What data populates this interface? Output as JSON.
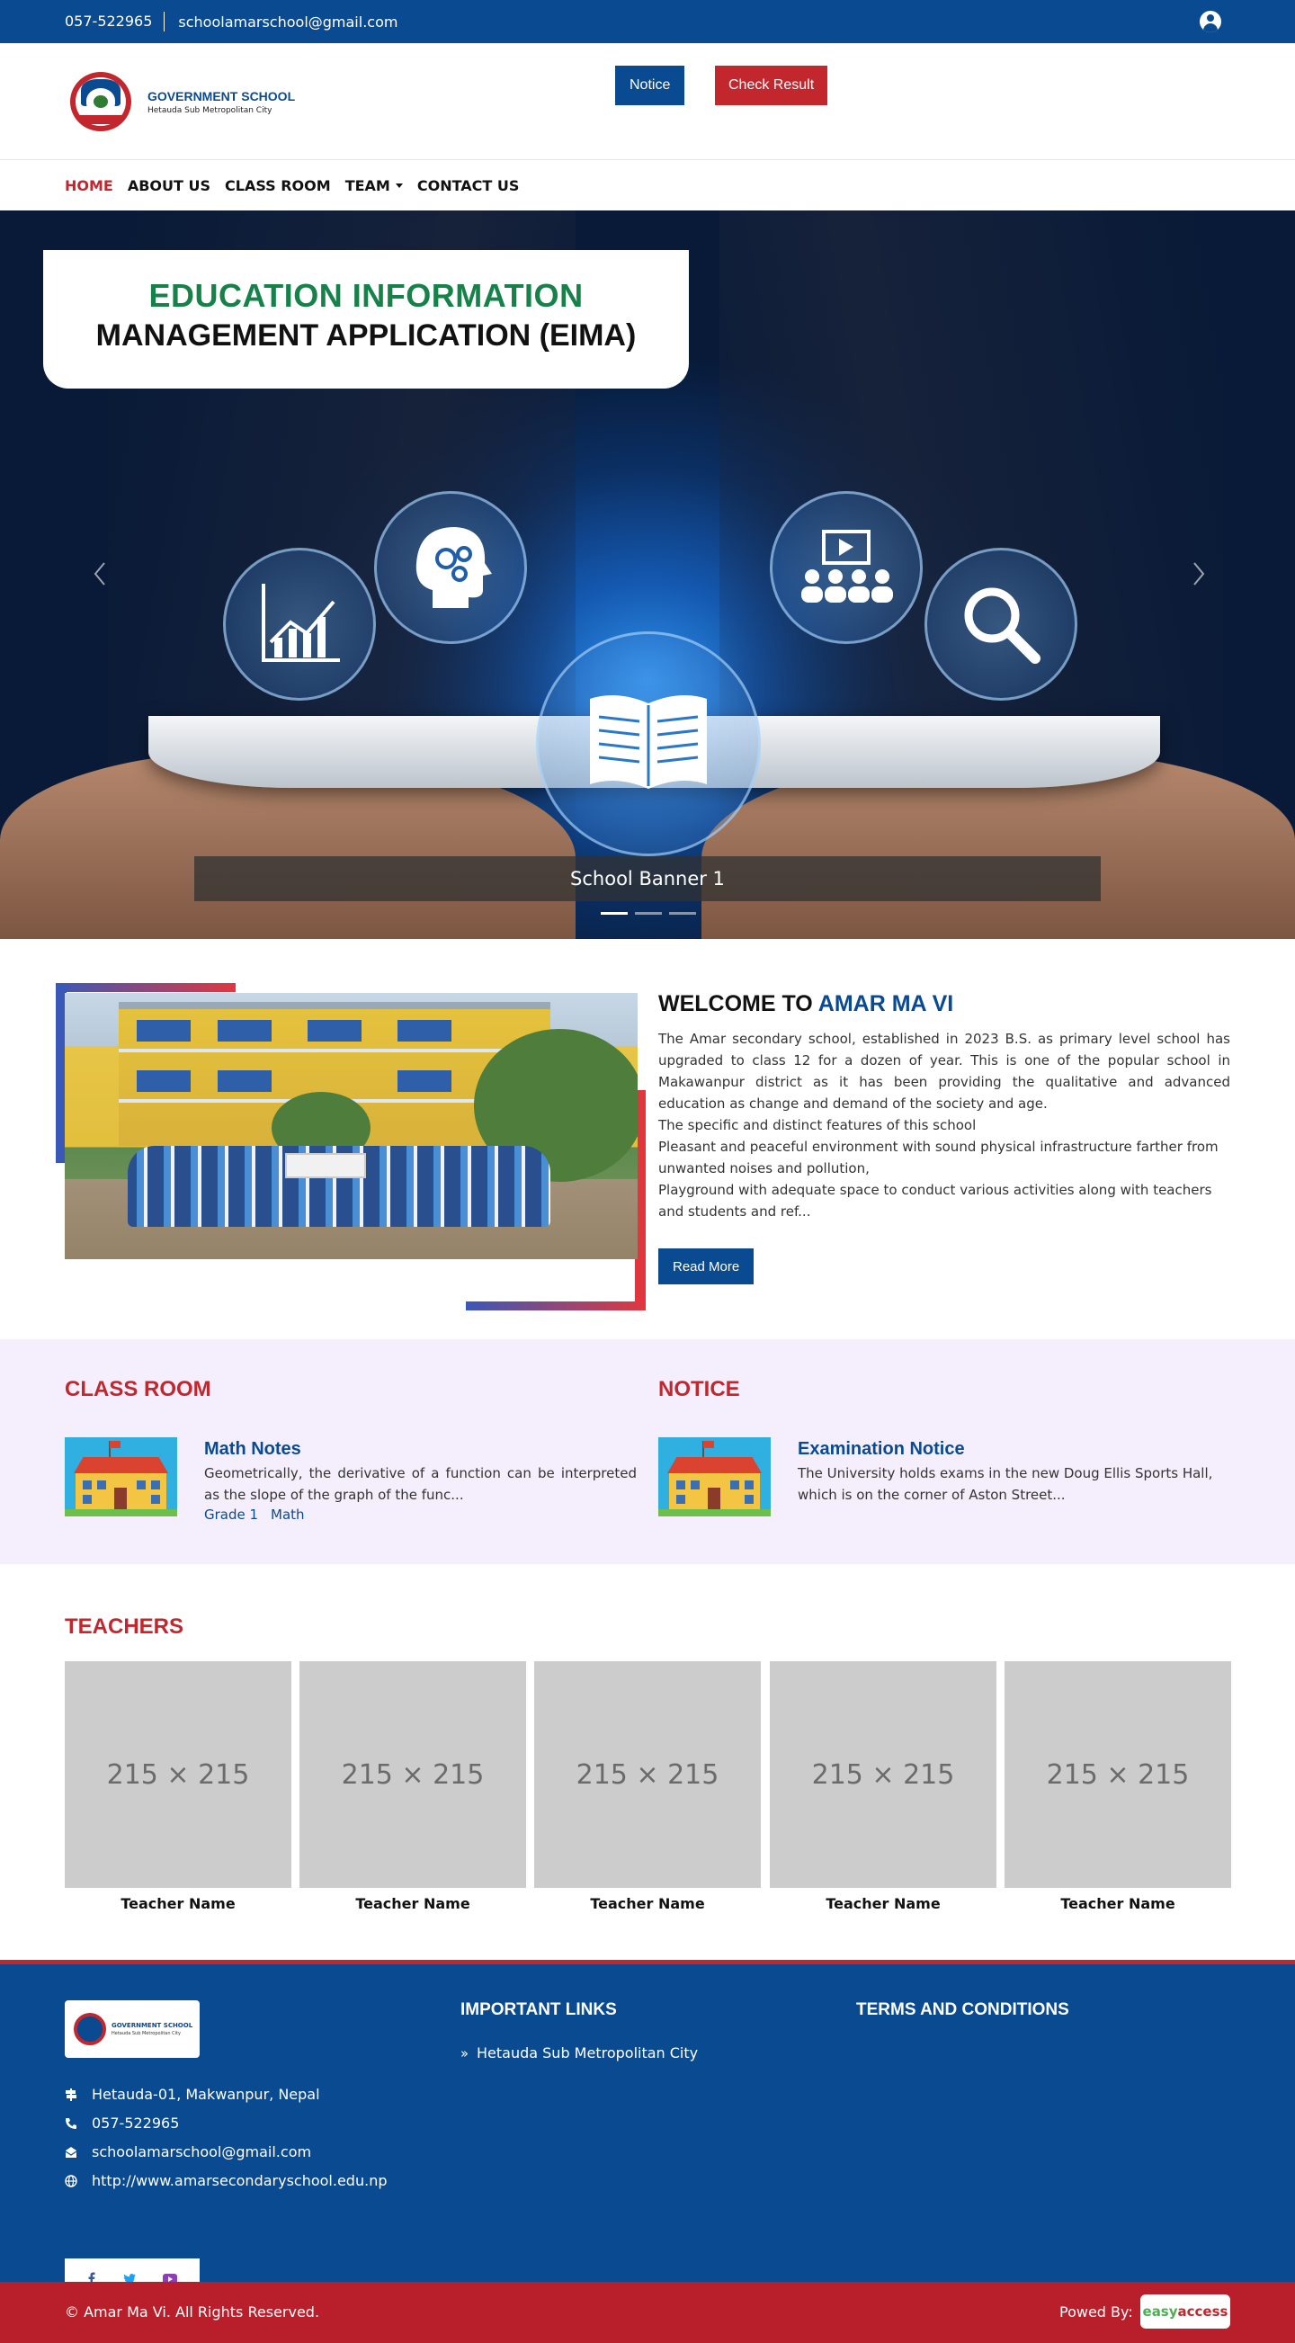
{
  "topbar": {
    "phone": "057-522965",
    "email": "schoolamarschool@gmail.com"
  },
  "header": {
    "logo_title": "GOVERNMENT SCHOOL",
    "logo_subtitle": "Hetauda Sub Metropolitan City",
    "notice_label": "Notice",
    "result_label": "Check Result"
  },
  "nav": {
    "items": [
      "HOME",
      "ABOUT US",
      "CLASS ROOM",
      "TEAM",
      "CONTACT US"
    ],
    "active": "HOME"
  },
  "hero": {
    "title_line1": "EDUCATION INFORMATION",
    "title_line2": "MANAGEMENT APPLICATION (EIMA)",
    "caption": "School Banner 1",
    "slide_count": 3,
    "active_slide": 1
  },
  "welcome": {
    "heading_prefix": "WELCOME TO ",
    "heading_highlight": "AMAR MA VI",
    "paragraphs": [
      "The Amar secondary school, established in 2023 B.S. as primary level school has upgraded to class 12 for a dozen of year. This is one of the popular school in Makawanpur district as it has been providing the qualitative and advanced education as change and demand of the society and age.",
      "The specific and distinct features of this school",
      "Pleasant and peaceful environment with sound physical infrastructure farther from unwanted noises and pollution,",
      "Playground with adequate space to  conduct various activities along with teachers and students and ref..."
    ],
    "read_more": "Read More"
  },
  "classroom": {
    "heading": "CLASS ROOM",
    "item_title": "Math Notes",
    "item_desc": "Geometrically, the derivative of a function can be interpreted as the slope of the graph of the func...",
    "tags": [
      "Grade 1",
      "Math"
    ]
  },
  "notice": {
    "heading": "NOTICE",
    "item_title": "Examination Notice",
    "item_desc": "The University holds exams in the new Doug Ellis Sports Hall, which is on the corner of Aston Street..."
  },
  "teachers": {
    "heading": "TEACHERS",
    "placeholder": "215 × 215",
    "names": [
      "Teacher Name",
      "Teacher Name",
      "Teacher Name",
      "Teacher Name",
      "Teacher Name"
    ]
  },
  "footer": {
    "logo_title": "GOVERNMENT SCHOOL",
    "logo_subtitle": "Hetauda Sub Metropolitan City",
    "address": "Hetauda-01, Makwanpur, Nepal",
    "phone": "057-522965",
    "email": "schoolamarschool@gmail.com",
    "website": "http://www.amarsecondaryschool.edu.np",
    "links_heading": "IMPORTANT LINKS",
    "links": [
      "Hetauda Sub Metropolitan City"
    ],
    "terms_heading": "TERMS AND CONDITIONS",
    "social": [
      "facebook-icon",
      "twitter-icon",
      "youtube-icon"
    ]
  },
  "bottombar": {
    "copyright": "© Amar Ma Vi. All Rights Reserved.",
    "powered_by": "Powed By:",
    "brand_part1": "easy",
    "brand_part2": "access"
  },
  "colors": {
    "primary": "#0a4a91",
    "accent": "#c1272d",
    "green": "#16824a",
    "band": "#f5effd"
  }
}
